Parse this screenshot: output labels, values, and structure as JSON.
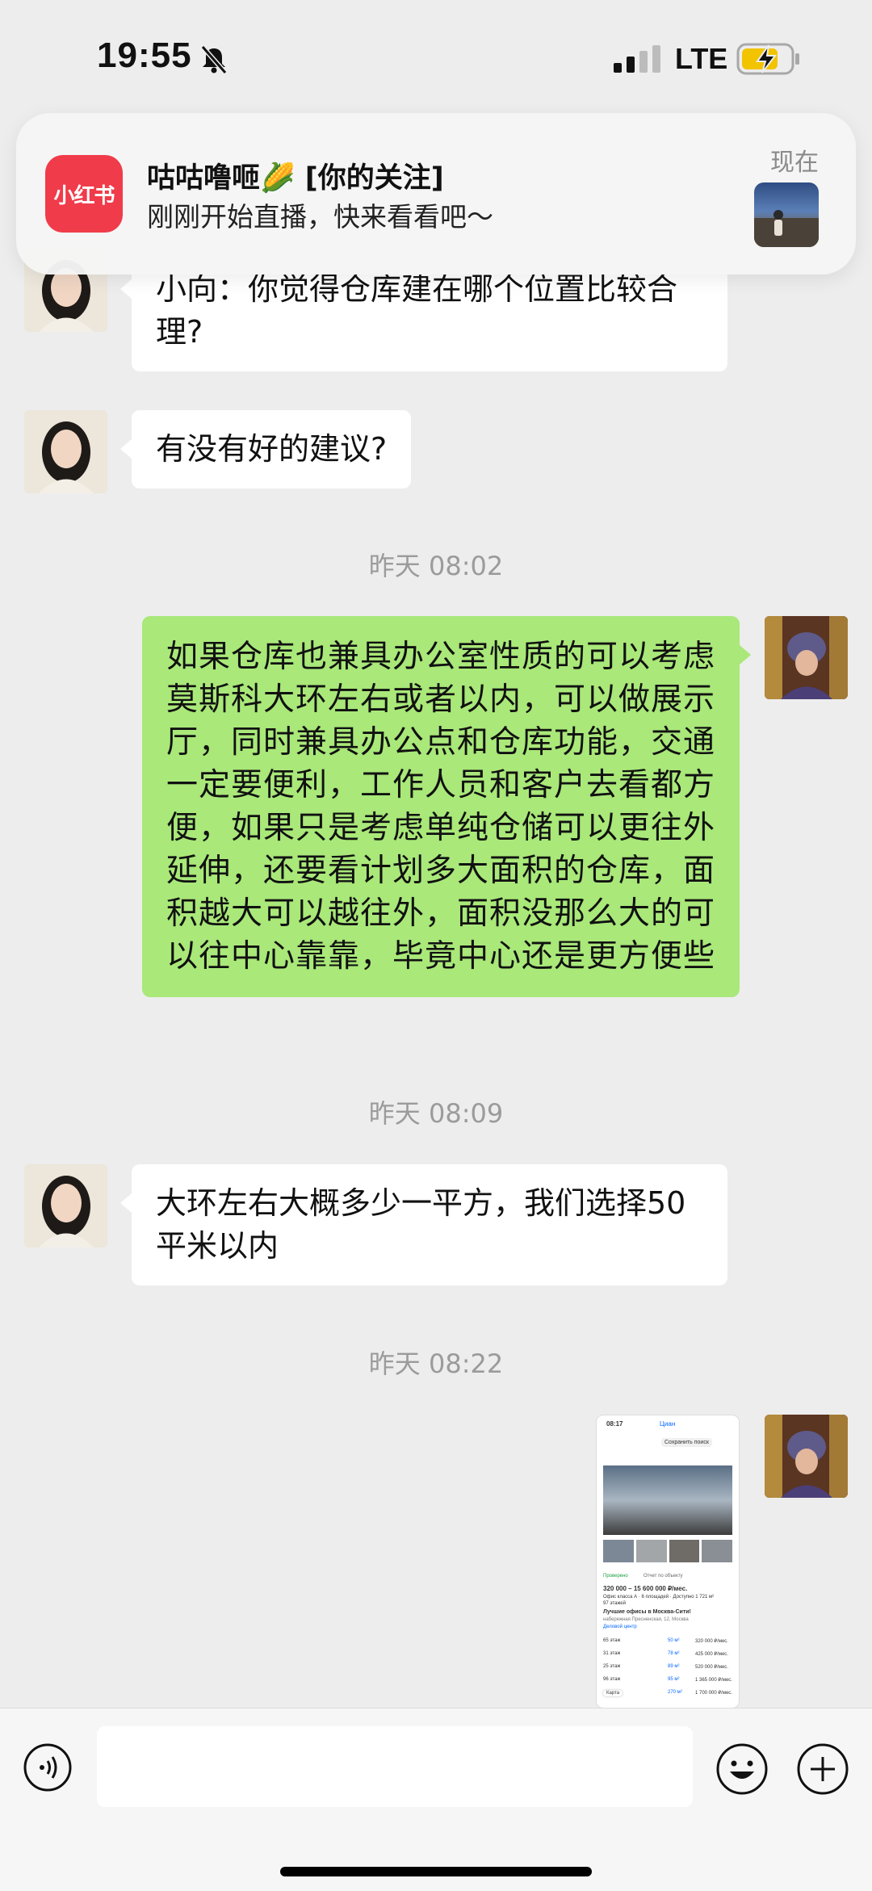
{
  "status_bar": {
    "time": "19:55",
    "network": "LTE"
  },
  "notification": {
    "app_icon_text": "小红书",
    "title": "咕咕噜咂🌽 [你的关注]",
    "body": "刚刚开始直播，快来看看吧～",
    "time": "现在"
  },
  "messages": [
    {
      "side": "left",
      "text": "小向：你觉得仓库建在哪个位置比较合理?"
    },
    {
      "side": "left",
      "text": "有没有好的建议?"
    },
    {
      "type": "timestamp",
      "text": "昨天 08:02"
    },
    {
      "side": "right",
      "text": "如果仓库也兼具办公室性质的可以考虑莫斯科大环左右或者以内，可以做展示厅，同时兼具办公点和仓库功能，交通一定要便利，工作人员和客户去看都方便，如果只是考虑单纯仓储可以更往外延伸，还要看计划多大面积的仓库，面积越大可以越往外，面积没那么大的可以往中心靠靠，毕竟中心还是更方便些"
    },
    {
      "type": "timestamp",
      "text": "昨天 08:09"
    },
    {
      "side": "left",
      "text": "大环左右大概多少一平方，我们选择50平米以内"
    },
    {
      "type": "timestamp",
      "text": "昨天 08:22"
    },
    {
      "side": "right",
      "type": "image"
    }
  ],
  "image_message": {
    "time": "08:17",
    "app": "Циан",
    "save_label": "Сохранить поиск",
    "badge": "Проверено",
    "badge2": "Отчет по объекту",
    "price": "320 000 – 15 600 000 ₽/мес.",
    "class_line": "Офис класса А · 6 площадей · Доступно 1 721 м²",
    "floors": "97 этажей",
    "headline": "Лучшие офисы в Москва-Сити!",
    "address": "набережная Пресненская, 12, Москва",
    "center": "Деловой центр",
    "rows": [
      {
        "floor": "65 этаж",
        "area": "50 м²",
        "price": "320 000 ₽/мес."
      },
      {
        "floor": "31 этаж",
        "area": "78 м²",
        "price": "425 000 ₽/мес."
      },
      {
        "floor": "25 этаж",
        "area": "89 м²",
        "price": "520 000 ₽/мес."
      },
      {
        "floor": "96 этаж",
        "area": "95 м²",
        "price": "1 365 000 ₽/мес."
      },
      {
        "floor": "",
        "area": "270 м²",
        "price": "1 700 000 ₽/мес."
      }
    ],
    "map_label": "Карта"
  }
}
